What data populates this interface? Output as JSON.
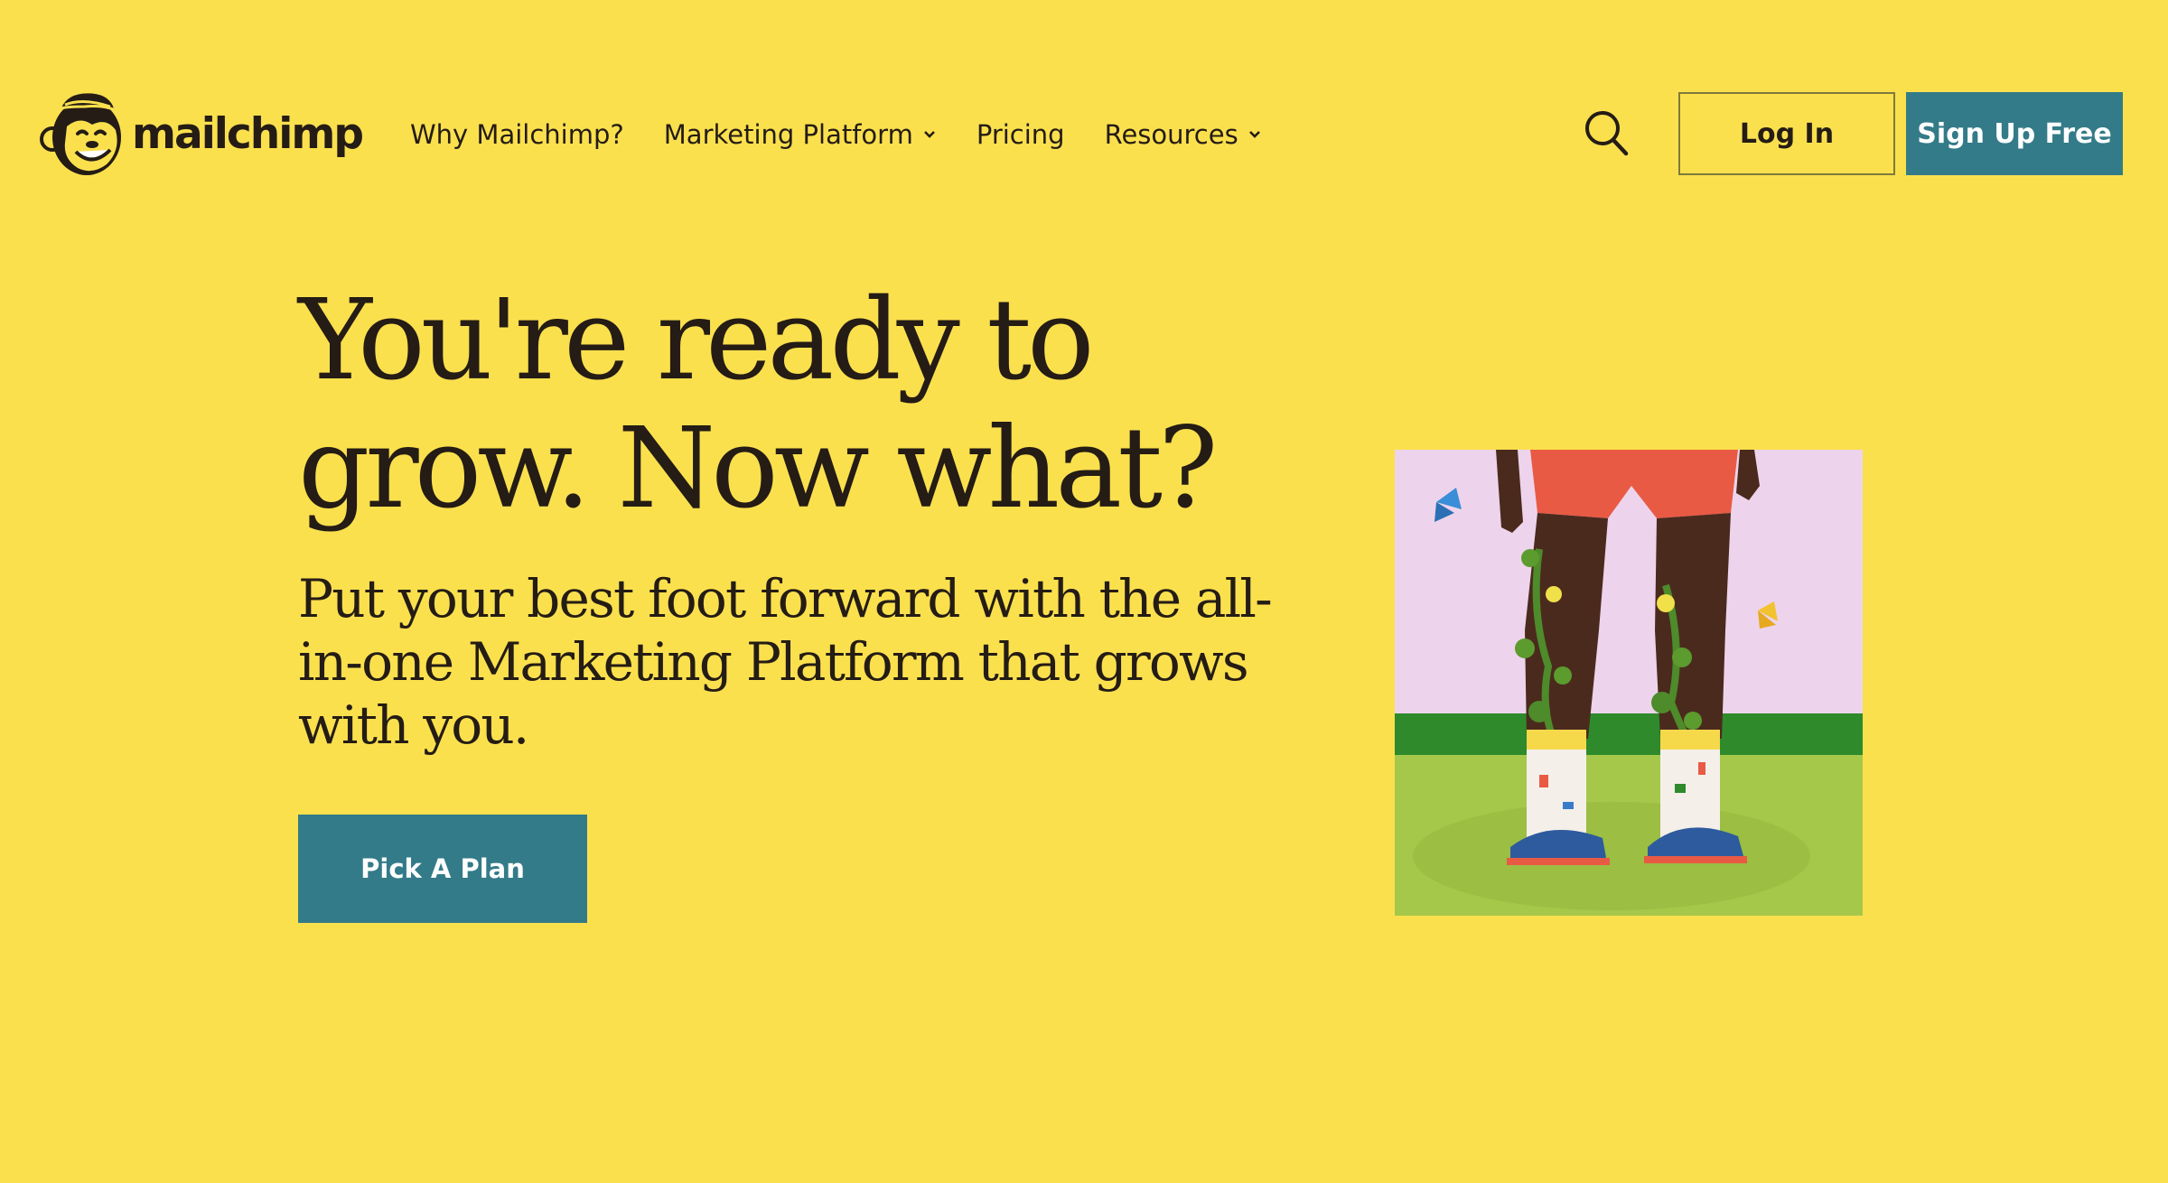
{
  "header": {
    "brand_name": "mailchimp",
    "nav": [
      {
        "label": "Why Mailchimp?",
        "has_dropdown": false
      },
      {
        "label": "Marketing Platform",
        "has_dropdown": true
      },
      {
        "label": "Pricing",
        "has_dropdown": false
      },
      {
        "label": "Resources",
        "has_dropdown": true
      }
    ],
    "search_icon": "search-icon",
    "login_label": "Log In",
    "signup_label": "Sign Up Free"
  },
  "hero": {
    "title": "You're ready to grow. Now what?",
    "subtitle": "Put your best foot forward with the all-in-one Marketing Platform that grows with you.",
    "cta_label": "Pick A Plan"
  },
  "colors": {
    "background": "#FBE04E",
    "accent": "#337B88",
    "text": "#241C15"
  }
}
